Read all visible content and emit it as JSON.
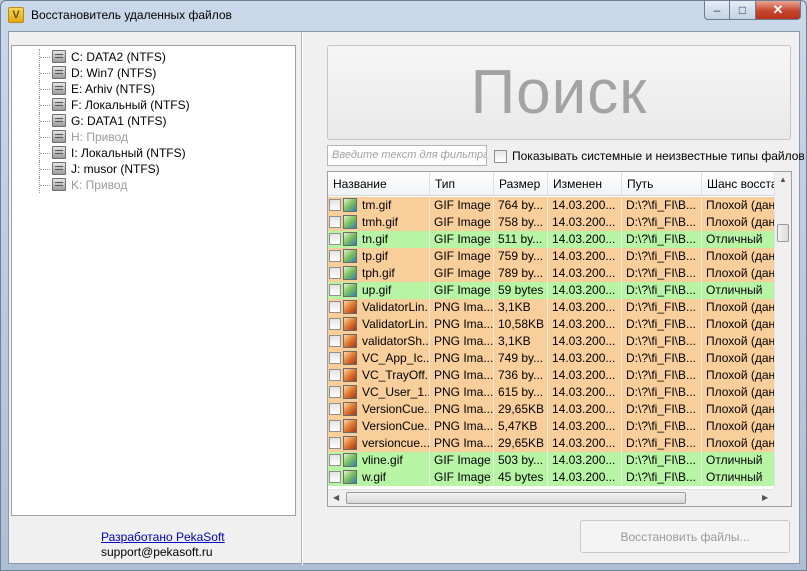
{
  "window": {
    "title": "Восстановитель удаленных файлов",
    "minimize_glyph": "–",
    "maximize_glyph": "□",
    "close_glyph": "✕"
  },
  "drives": [
    {
      "label": "C: DATA2 (NTFS)",
      "disabled": false
    },
    {
      "label": "D: Win7 (NTFS)",
      "disabled": false
    },
    {
      "label": "E: Arhiv (NTFS)",
      "disabled": false
    },
    {
      "label": "F: Локальный (NTFS)",
      "disabled": false
    },
    {
      "label": "G: DATA1 (NTFS)",
      "disabled": false
    },
    {
      "label": "H: Привод",
      "disabled": true
    },
    {
      "label": "I: Локальный (NTFS)",
      "disabled": false
    },
    {
      "label": "J: musor (NTFS)",
      "disabled": false
    },
    {
      "label": "K: Привод",
      "disabled": true
    }
  ],
  "credits": {
    "link": "Разработано PekaSoft",
    "email": "support@pekasoft.ru"
  },
  "search": {
    "label": "Поиск"
  },
  "filter": {
    "placeholder": "Введите текст для фильтра ре",
    "show_system_label": "Показывать системные и неизвестные типы файлов"
  },
  "table": {
    "columns": [
      "Название",
      "Тип",
      "Размер",
      "Изменен",
      "Путь",
      "Шанс восстан"
    ],
    "rows": [
      {
        "name": "tm.gif",
        "type": "GIF Image",
        "size": "764 by...",
        "modified": "14.03.200...",
        "path": "D:\\?\\fi_FI\\B...",
        "chance": "Плохой (данн",
        "status": "bad",
        "icon": "gif"
      },
      {
        "name": "tmh.gif",
        "type": "GIF Image",
        "size": "758 by...",
        "modified": "14.03.200...",
        "path": "D:\\?\\fi_FI\\B...",
        "chance": "Плохой (данн",
        "status": "bad",
        "icon": "gif"
      },
      {
        "name": "tn.gif",
        "type": "GIF Image",
        "size": "511 by...",
        "modified": "14.03.200...",
        "path": "D:\\?\\fi_FI\\B...",
        "chance": "Отличный",
        "status": "good",
        "icon": "gif"
      },
      {
        "name": "tp.gif",
        "type": "GIF Image",
        "size": "759 by...",
        "modified": "14.03.200...",
        "path": "D:\\?\\fi_FI\\B...",
        "chance": "Плохой (данн",
        "status": "bad",
        "icon": "gif"
      },
      {
        "name": "tph.gif",
        "type": "GIF Image",
        "size": "789 by...",
        "modified": "14.03.200...",
        "path": "D:\\?\\fi_FI\\B...",
        "chance": "Плохой (данн",
        "status": "bad",
        "icon": "gif"
      },
      {
        "name": "up.gif",
        "type": "GIF Image",
        "size": "59 bytes",
        "modified": "14.03.200...",
        "path": "D:\\?\\fi_FI\\B...",
        "chance": "Отличный",
        "status": "good",
        "icon": "gif"
      },
      {
        "name": "ValidatorLin...",
        "type": "PNG Ima...",
        "size": "3,1KB",
        "modified": "14.03.200...",
        "path": "D:\\?\\fi_FI\\B...",
        "chance": "Плохой (данн",
        "status": "bad",
        "icon": "png"
      },
      {
        "name": "ValidatorLin...",
        "type": "PNG Ima...",
        "size": "10,58KB",
        "modified": "14.03.200...",
        "path": "D:\\?\\fi_FI\\B...",
        "chance": "Плохой (данн",
        "status": "bad",
        "icon": "png"
      },
      {
        "name": "validatorSh...",
        "type": "PNG Ima...",
        "size": "3,1KB",
        "modified": "14.03.200...",
        "path": "D:\\?\\fi_FI\\B...",
        "chance": "Плохой (данн",
        "status": "bad",
        "icon": "png"
      },
      {
        "name": "VC_App_Ic...",
        "type": "PNG Ima...",
        "size": "749 by...",
        "modified": "14.03.200...",
        "path": "D:\\?\\fi_FI\\B...",
        "chance": "Плохой (данн",
        "status": "bad",
        "icon": "png"
      },
      {
        "name": "VC_TrayOff...",
        "type": "PNG Ima...",
        "size": "736 by...",
        "modified": "14.03.200...",
        "path": "D:\\?\\fi_FI\\B...",
        "chance": "Плохой (данн",
        "status": "bad",
        "icon": "png"
      },
      {
        "name": "VC_User_1...",
        "type": "PNG Ima...",
        "size": "615 by...",
        "modified": "14.03.200...",
        "path": "D:\\?\\fi_FI\\B...",
        "chance": "Плохой (данн",
        "status": "bad",
        "icon": "png"
      },
      {
        "name": "VersionCue...",
        "type": "PNG Ima...",
        "size": "29,65KB",
        "modified": "14.03.200...",
        "path": "D:\\?\\fi_FI\\B...",
        "chance": "Плохой (данн",
        "status": "bad",
        "icon": "png"
      },
      {
        "name": "VersionCue...",
        "type": "PNG Ima...",
        "size": "5,47KB",
        "modified": "14.03.200...",
        "path": "D:\\?\\fi_FI\\B...",
        "chance": "Плохой (данн",
        "status": "bad",
        "icon": "png"
      },
      {
        "name": "versioncue...",
        "type": "PNG Ima...",
        "size": "29,65KB",
        "modified": "14.03.200...",
        "path": "D:\\?\\fi_FI\\B...",
        "chance": "Плохой (данн",
        "status": "bad",
        "icon": "png"
      },
      {
        "name": "vline.gif",
        "type": "GIF Image",
        "size": "503 by...",
        "modified": "14.03.200...",
        "path": "D:\\?\\fi_FI\\B...",
        "chance": "Отличный",
        "status": "good",
        "icon": "gif"
      },
      {
        "name": "w.gif",
        "type": "GIF Image",
        "size": "45 bytes",
        "modified": "14.03.200...",
        "path": "D:\\?\\fi_FI\\B...",
        "chance": "Отличный",
        "status": "good",
        "icon": "gif"
      }
    ]
  },
  "restore": {
    "label": "Восстановить файлы..."
  },
  "colors": {
    "bad_row": "#f8cf9b",
    "good_row": "#b7f5a5",
    "link": "#0000c0"
  }
}
